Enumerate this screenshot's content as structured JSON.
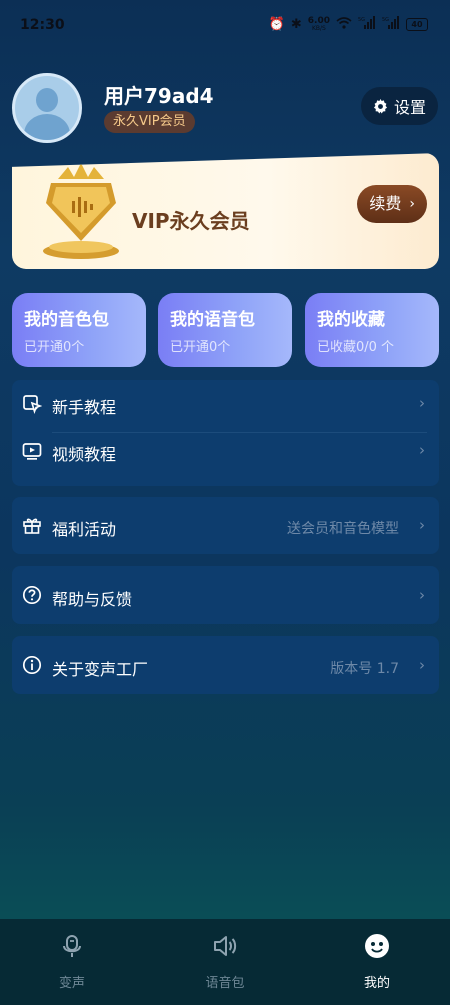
{
  "status_bar": {
    "time": "12:30",
    "net_speed_value": "6.00",
    "net_speed_unit": "KB/S",
    "signal1": "5G",
    "signal2": "5G",
    "battery": "40"
  },
  "profile": {
    "username": "用户79ad4",
    "vip_badge": "永久VIP会员",
    "settings_label": "设置"
  },
  "vip_card": {
    "title": "VIP永久会员",
    "renew_label": "续费"
  },
  "features": [
    {
      "title": "我的音色包",
      "subtitle": "已开通0个"
    },
    {
      "title": "我的语音包",
      "subtitle": "已开通0个"
    },
    {
      "title": "我的收藏",
      "subtitle": "已收藏0/0 个"
    }
  ],
  "menu": {
    "tutorial_beginner": "新手教程",
    "tutorial_video": "视频教程",
    "benefits": "福利活动",
    "benefits_extra": "送会员和音色模型",
    "help": "帮助与反馈",
    "about": "关于变声工厂",
    "about_extra": "版本号 1.7"
  },
  "bottom_nav": [
    {
      "label": "变声",
      "active": false
    },
    {
      "label": "语音包",
      "active": false
    },
    {
      "label": "我的",
      "active": true
    }
  ],
  "colors": {
    "accent_vip_text": "#6b3e1f",
    "feature_card": "#7a7ef5",
    "menu_bg": "#0d3d6e"
  }
}
